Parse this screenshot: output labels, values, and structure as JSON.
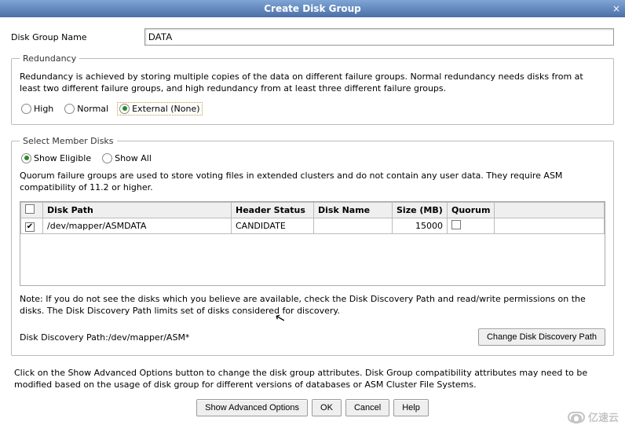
{
  "window": {
    "title": "Create Disk Group",
    "close_glyph": "×"
  },
  "disk_group_name": {
    "label": "Disk Group Name",
    "value": "DATA"
  },
  "redundancy": {
    "legend": "Redundancy",
    "description": "Redundancy is achieved by storing multiple copies of the data on different failure groups. Normal redundancy needs disks from at least two different failure groups, and high redundancy from at least three different failure groups.",
    "options": {
      "high": "High",
      "normal": "Normal",
      "external": "External (None)"
    },
    "selected": "external"
  },
  "member_disks": {
    "legend": "Select Member Disks",
    "filter": {
      "eligible": "Show Eligible",
      "all": "Show All",
      "selected": "eligible"
    },
    "quorum_note": "Quorum failure groups are used to store voting files in extended clusters and do not contain any user data. They require ASM compatibility of 11.2 or higher.",
    "columns": {
      "disk_path": "Disk Path",
      "header_status": "Header Status",
      "disk_name": "Disk Name",
      "size_mb": "Size (MB)",
      "quorum": "Quorum"
    },
    "rows": [
      {
        "checked": true,
        "disk_path": "/dev/mapper/ASMDATA",
        "header_status": "CANDIDATE",
        "disk_name": "",
        "size_mb": "15000",
        "quorum": false
      }
    ],
    "note": "Note: If you do not see the disks which you believe are available, check the Disk Discovery Path and read/write permissions on the disks. The Disk Discovery Path limits set of disks considered for discovery.",
    "discovery_path_label": "Disk Discovery Path:",
    "discovery_path_value": "/dev/mapper/ASM*",
    "change_path_button": "Change Disk Discovery Path"
  },
  "footer_text": "Click on the Show Advanced Options button to change the disk group attributes. Disk Group compatibility attributes may need to be modified based on the usage of disk group for different versions of databases or ASM Cluster File Systems.",
  "buttons": {
    "advanced": "Show Advanced Options",
    "ok": "OK",
    "cancel": "Cancel",
    "help": "Help"
  },
  "watermark": "亿速云"
}
